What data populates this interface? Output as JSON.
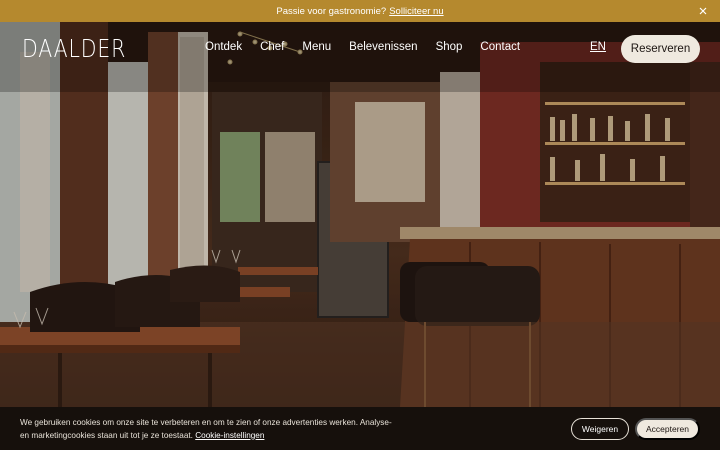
{
  "announcement": {
    "text": "Passie voor gastronomie?",
    "link": "Solliciteer nu"
  },
  "header": {
    "logo": "DAALDER",
    "nav": [
      "Ontdek",
      "Chef",
      "Menu",
      "Belevenissen",
      "Shop",
      "Contact"
    ],
    "language": "EN",
    "reserve_label": "Reserveren"
  },
  "hero": {
    "image": "restaurant-interior-photo"
  },
  "cookie_banner": {
    "text": "We gebruiken cookies om onze site te verbeteren en om te zien of onze advertenties werken. Analyse- en marketingcookies staan uit tot je ze toestaat.",
    "settings_link": "Cookie-instellingen",
    "decline_label": "Weigeren",
    "accept_label": "Accepteren"
  },
  "colors": {
    "announcement_bg": "#b5892e",
    "button_bg": "#efe9df",
    "cookie_bg": "#16100c"
  }
}
